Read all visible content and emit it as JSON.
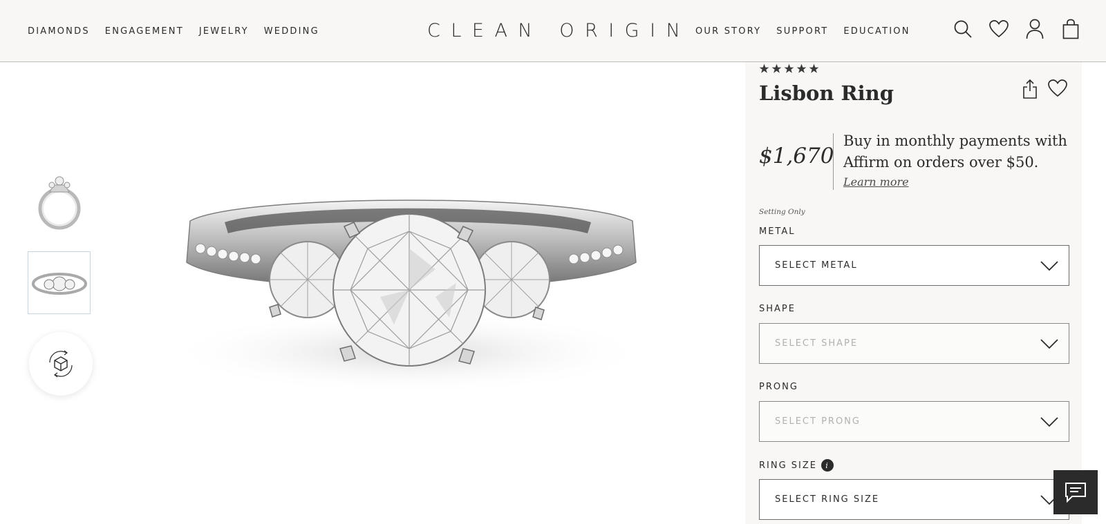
{
  "header": {
    "logo": "CLEAN ORIGIN",
    "nav_left": [
      "DIAMONDS",
      "ENGAGEMENT",
      "JEWELRY",
      "WEDDING"
    ],
    "nav_right": [
      "OUR STORY",
      "SUPPORT",
      "EDUCATION"
    ],
    "icons": [
      "search-icon",
      "heart-icon",
      "user-icon",
      "shopping-bag-icon"
    ]
  },
  "gallery": {
    "thumbnails": [
      "ring-side-view-thumbnail",
      "ring-front-view-thumbnail"
    ],
    "selected_thumbnail": 2,
    "view_360_icon": "360-rotate-icon"
  },
  "product": {
    "rating_stars": 5,
    "title": "Lisbon Ring",
    "price": "$1,670",
    "affirm_text": "Buy in monthly payments with Affirm on orders over $50.",
    "learn_more": "Learn more",
    "setting_note": "Setting Only",
    "fields": {
      "metal": {
        "label": "METAL",
        "value": "SELECT METAL"
      },
      "shape": {
        "label": "SHAPE",
        "value": "SELECT SHAPE"
      },
      "prong": {
        "label": "PRONG",
        "value": "SELECT PRONG"
      },
      "ring_size": {
        "label": "RING SIZE",
        "value": "SELECT RING SIZE",
        "info_glyph": "i"
      }
    }
  },
  "colors": {
    "header_bg": "#f8f7f5",
    "panel_bg": "#f8f7f5",
    "text": "#2b2b2b",
    "chat_button_bg": "#2b2b2b"
  }
}
